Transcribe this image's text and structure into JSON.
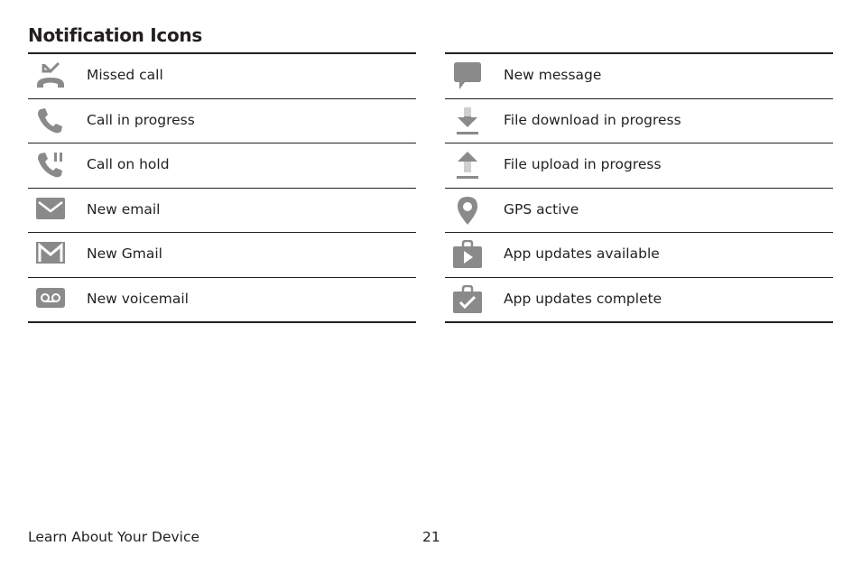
{
  "page": {
    "title": "Notification Icons",
    "footer_section": "Learn About Your Device",
    "page_number": "21"
  },
  "left_items": [
    {
      "icon": "missed-call-icon",
      "label": "Missed call"
    },
    {
      "icon": "call-in-progress-icon",
      "label": "Call in progress"
    },
    {
      "icon": "call-on-hold-icon",
      "label": "Call on hold"
    },
    {
      "icon": "email-icon",
      "label": "New email"
    },
    {
      "icon": "gmail-icon",
      "label": "New Gmail"
    },
    {
      "icon": "voicemail-icon",
      "label": "New voicemail"
    }
  ],
  "right_items": [
    {
      "icon": "message-icon",
      "label": "New message"
    },
    {
      "icon": "download-icon",
      "label": "File download in progress"
    },
    {
      "icon": "upload-icon",
      "label": "File upload in progress"
    },
    {
      "icon": "gps-icon",
      "label": "GPS active"
    },
    {
      "icon": "app-update-available-icon",
      "label": "App updates available"
    },
    {
      "icon": "app-update-complete-icon",
      "label": "App updates complete"
    }
  ],
  "colors": {
    "icon_gray": "#8a8a8a",
    "icon_light": "#cfcfcf",
    "text": "#231f20"
  }
}
